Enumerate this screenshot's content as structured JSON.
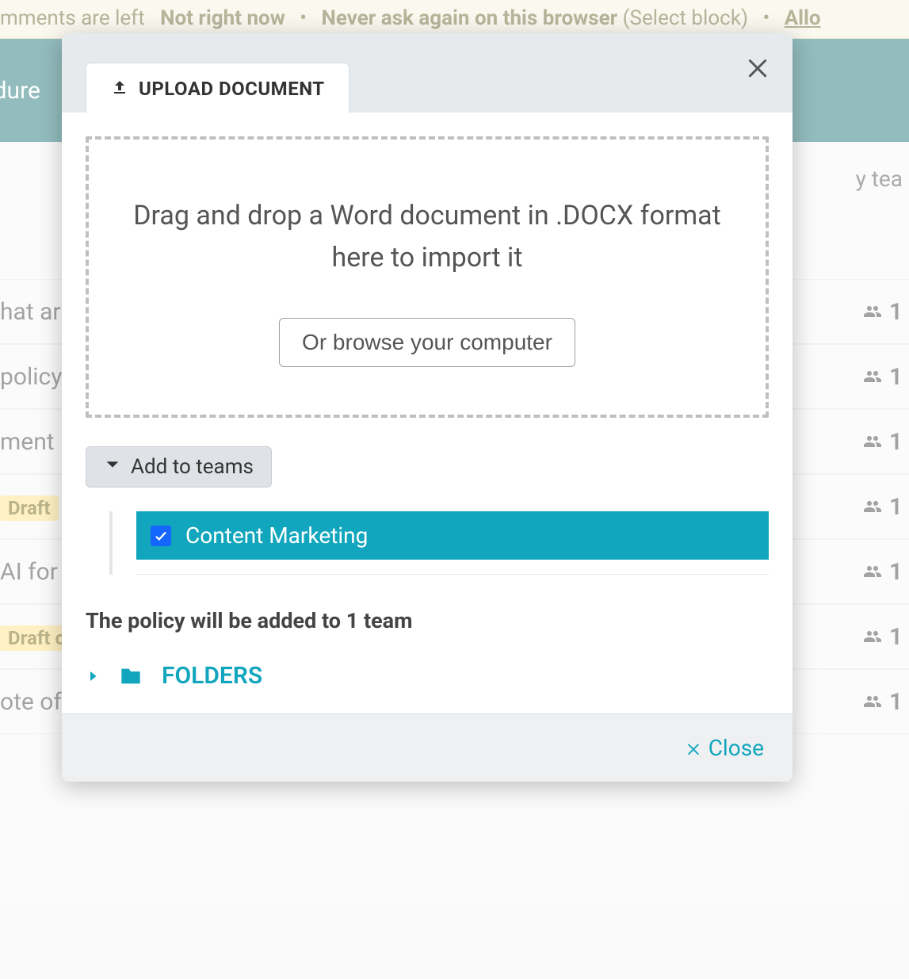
{
  "banner": {
    "left_frag": "mments are left",
    "not_now": "Not right now",
    "never": "Never ask again on this browser",
    "select_block": "(Select block)",
    "allow_frag": "Allo"
  },
  "tealbar": {
    "frag": "cedure"
  },
  "bg_byteam": "y tea",
  "bg_rows": [
    {
      "left": "hat ar",
      "draft": null,
      "count": "1"
    },
    {
      "left": "policy",
      "draft": null,
      "count": "1"
    },
    {
      "left": "ment",
      "draft": null,
      "count": "1"
    },
    {
      "left": "",
      "draft": "Draft",
      "count": "1"
    },
    {
      "left": "AI for s",
      "draft": null,
      "count": "1"
    },
    {
      "left": "",
      "draft": "Draft c",
      "count": "1"
    },
    {
      "left": "ote of",
      "draft": null,
      "count": "1"
    }
  ],
  "modal": {
    "tab_label": "UPLOAD DOCUMENT",
    "drop_msg": "Drag and drop a Word document in .DOCX format here to import it",
    "browse_label": "Or browse your computer",
    "add_teams_label": "Add to teams",
    "team_name": "Content Marketing",
    "team_checked": true,
    "summary": "The policy will be added to 1 team",
    "folders_label": "FOLDERS",
    "close_label": "Close"
  }
}
